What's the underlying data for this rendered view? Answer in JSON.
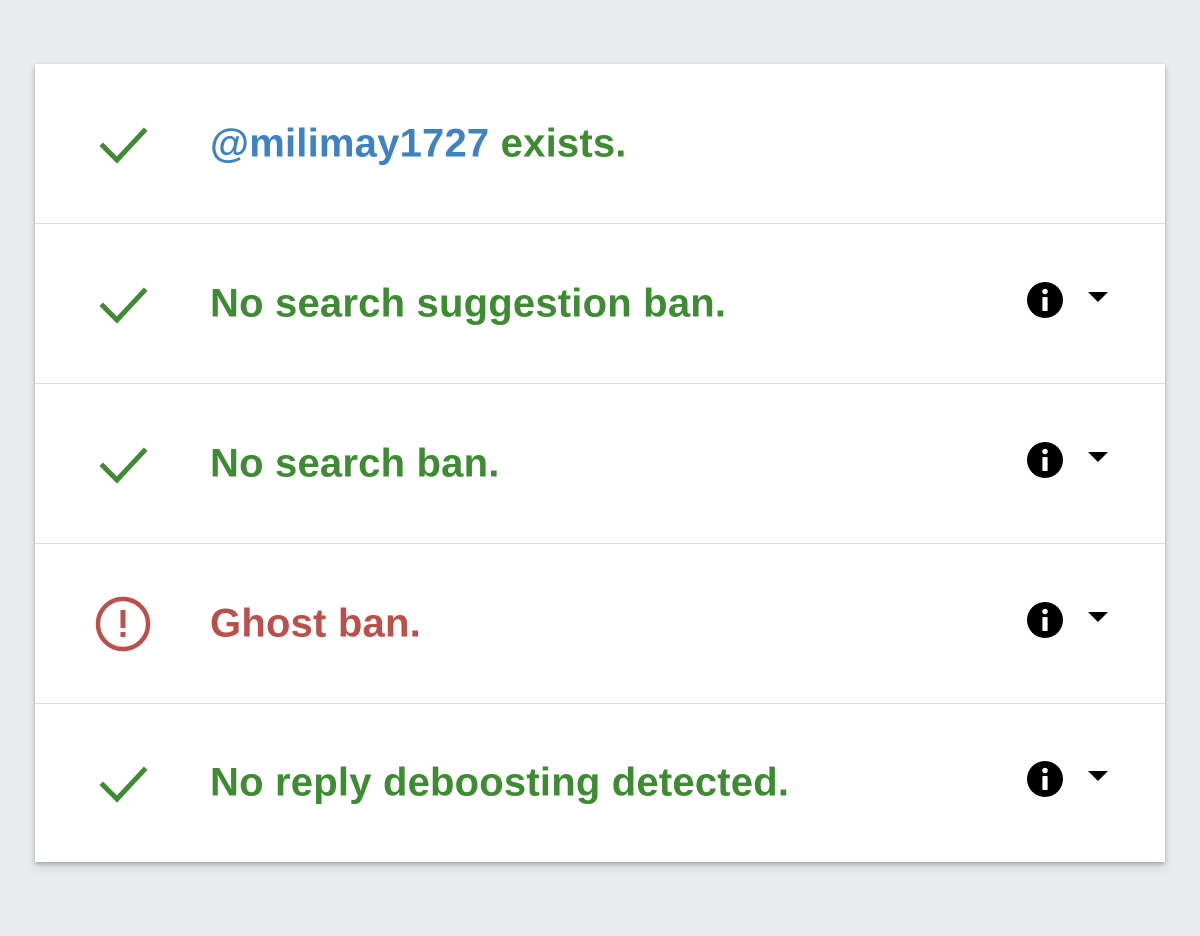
{
  "colors": {
    "background": "#e8ecef",
    "card": "#ffffff",
    "success": "#3f8b33",
    "error": "#b9504c",
    "link": "#3e82c2",
    "icon_dark": "#000000"
  },
  "rows": [
    {
      "status": "success",
      "status_icon": "check-icon",
      "username": "@milimay1727",
      "label": " exists.",
      "has_info": false
    },
    {
      "status": "success",
      "status_icon": "check-icon",
      "label": "No search suggestion ban.",
      "has_info": true,
      "info_icon": "info-icon",
      "toggle_icon": "chevron-down-icon"
    },
    {
      "status": "success",
      "status_icon": "check-icon",
      "label": "No search ban.",
      "has_info": true,
      "info_icon": "info-icon",
      "toggle_icon": "chevron-down-icon"
    },
    {
      "status": "error",
      "status_icon": "alert-circle-icon",
      "label": "Ghost ban.",
      "has_info": true,
      "info_icon": "info-icon",
      "toggle_icon": "chevron-down-icon"
    },
    {
      "status": "success",
      "status_icon": "check-icon",
      "label": "No reply deboosting detected.",
      "has_info": true,
      "info_icon": "info-icon",
      "toggle_icon": "chevron-down-icon"
    }
  ]
}
